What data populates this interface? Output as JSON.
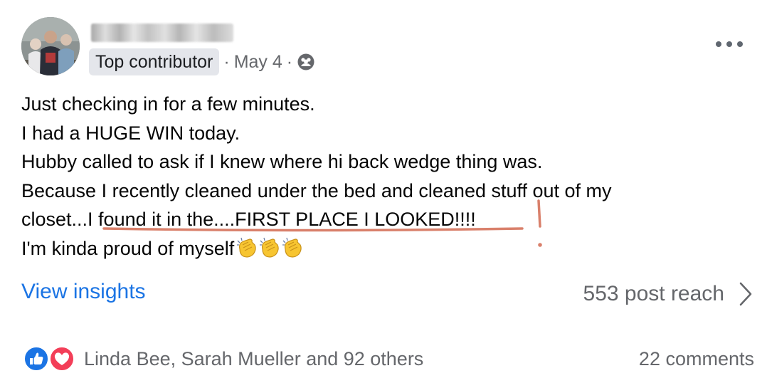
{
  "post": {
    "author_badge": "Top contributor",
    "date": "May 4",
    "separator": "·",
    "audience_icon": "group-icon",
    "more_icon": "more-options-icon",
    "lines": [
      "Just checking in for a few minutes.",
      "I had a HUGE WIN today.",
      "Hubby called to ask if I knew where hi back wedge thing was.",
      "Because I recently cleaned under the bed and cleaned stuff out of my"
    ],
    "line5_prefix": "closet...",
    "line5_highlight": "I found it in the....FIRST PLACE I LOOKED!!!!",
    "line6": "I'm kinda proud of myself",
    "emoji": "clapping-hands",
    "emoji_count": 3
  },
  "insights": {
    "view_label": "View insights",
    "reach_label": "553 post reach"
  },
  "footer": {
    "reaction_icons": [
      "like-icon",
      "love-icon"
    ],
    "reactors": "Linda Bee, Sarah Mueller and 92 others",
    "comments": "22 comments"
  },
  "colors": {
    "link_blue": "#1b74e4",
    "secondary_text": "#65676b",
    "annotation": "#d9806b",
    "badge_bg": "#e4e6eb"
  }
}
